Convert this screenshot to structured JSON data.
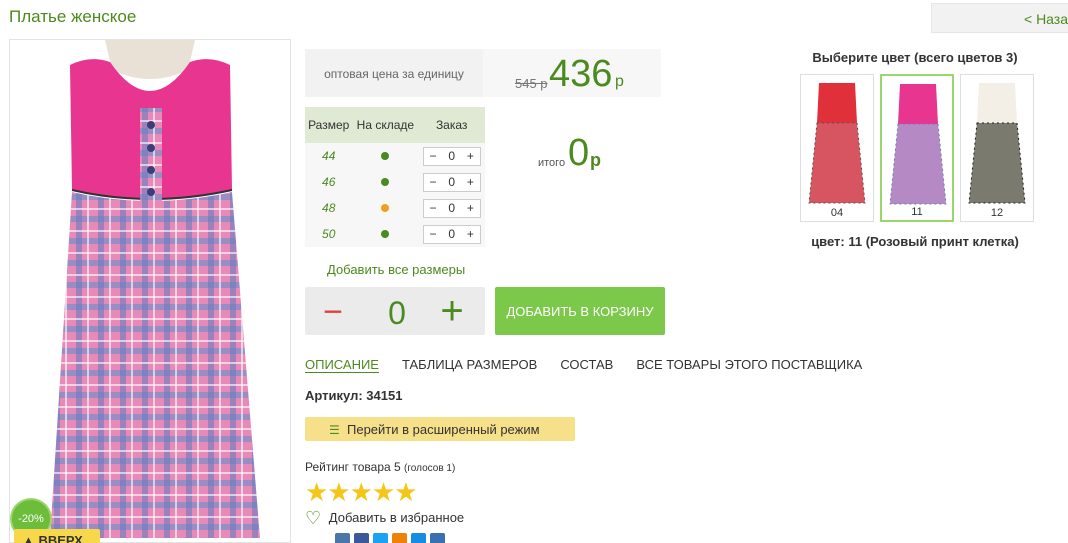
{
  "header": {
    "title": "Платье женское",
    "back_label": "< Наза"
  },
  "product": {
    "discount_badge": "-20%",
    "up_button": "▲ ВВЕРХ",
    "price_label": "оптовая цена за единицу",
    "old_price": "545 р",
    "new_price": "436",
    "currency": "р"
  },
  "sizes": {
    "headers": [
      "Размер",
      "На складе",
      "Заказ"
    ],
    "rows": [
      {
        "size": "44",
        "stock": "green",
        "qty": "0"
      },
      {
        "size": "46",
        "stock": "green",
        "qty": "0"
      },
      {
        "size": "48",
        "stock": "orange",
        "qty": "0"
      },
      {
        "size": "50",
        "stock": "green",
        "qty": "0"
      }
    ],
    "minus": "−",
    "plus": "+"
  },
  "total": {
    "label": "итого",
    "value": "0",
    "currency": "р"
  },
  "add_all_sizes": "Добавить все размеры",
  "quantity": {
    "minus": "−",
    "value": "0",
    "plus": "+"
  },
  "cart_button": "ДОБАВИТЬ В КОРЗИНУ",
  "tabs": [
    "ОПИСАНИЕ",
    "ТАБЛИЦА РАЗМЕРОВ",
    "СОСТАВ",
    "ВСЕ ТОВАРЫ ЭТОГО ПОСТАВЩИКА"
  ],
  "article": {
    "label": "Артикул:",
    "value": "34151"
  },
  "extended_mode": "Перейти в расширенный режим",
  "rating": {
    "text": "Рейтинг товара 5",
    "votes": "(голосов 1)",
    "stars": "★★★★★"
  },
  "favorites": {
    "icon": "heart-icon",
    "label": "Добавить в избранное"
  },
  "colors": {
    "title": "Выберите цвет (всего цветов 3)",
    "items": [
      {
        "code": "04"
      },
      {
        "code": "11"
      },
      {
        "code": "12"
      }
    ],
    "selected_text": "цвет: 11 (Розовый принт клетка)"
  },
  "palette": {
    "accent": "#4b8a1e",
    "button": "#7cc84a",
    "highlight": "#f7e08a",
    "pink": "#e8358f"
  }
}
